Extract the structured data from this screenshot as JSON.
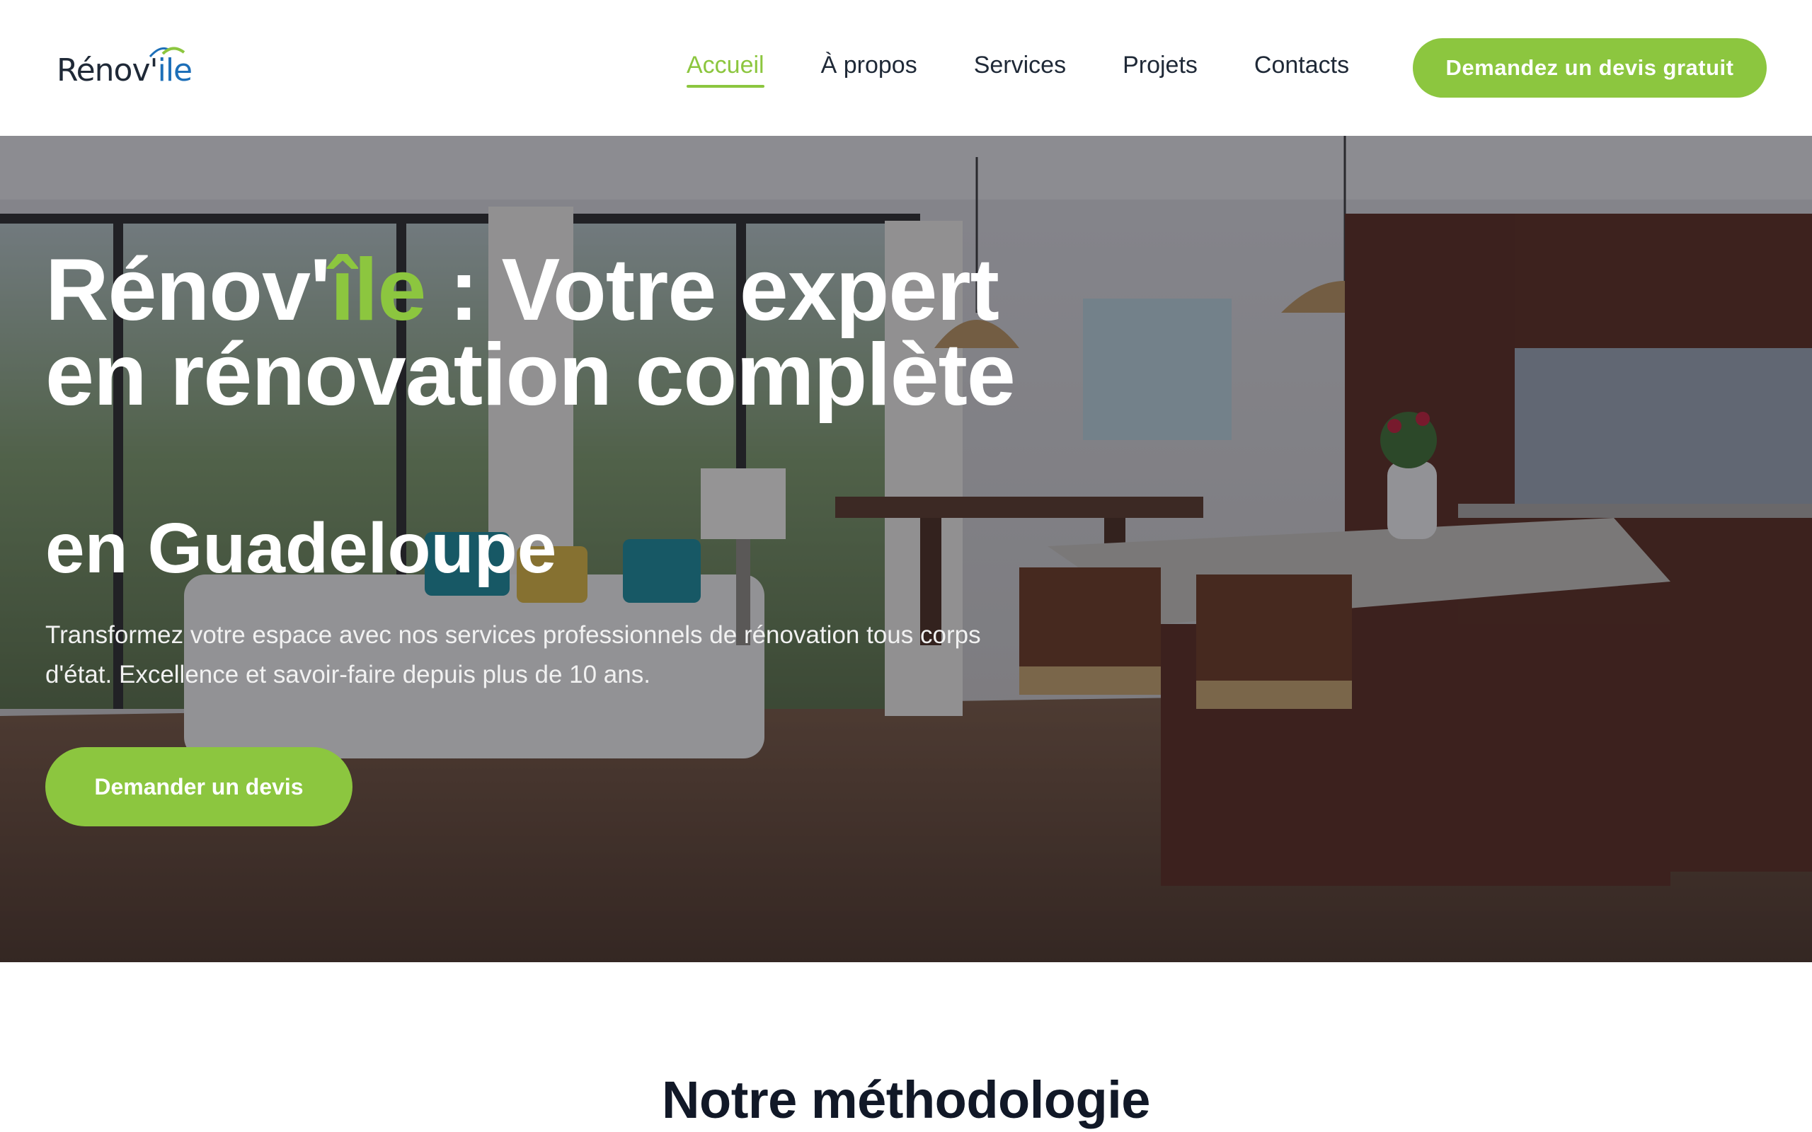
{
  "brand": {
    "logo_main": "Rénov'",
    "logo_accent": "ile"
  },
  "nav": {
    "items": [
      {
        "label": "Accueil",
        "active": true
      },
      {
        "label": "À propos",
        "active": false
      },
      {
        "label": "Services",
        "active": false
      },
      {
        "label": "Projets",
        "active": false
      },
      {
        "label": "Contacts",
        "active": false
      }
    ],
    "cta_label": "Demandez un devis gratuit"
  },
  "hero": {
    "title_part1": "Rénov'",
    "title_accent": "île",
    "title_part2": " : Votre expert en rénovation complète",
    "subtitle": "en Guadeloupe",
    "description": "Transformez votre espace avec nos services professionnels de rénovation tous corps d'état. Excellence et savoir-faire depuis plus de 10 ans.",
    "cta_label": "Demander un devis"
  },
  "methodology": {
    "title": "Notre méthodologie"
  },
  "colors": {
    "accent": "#8cc63f",
    "logo_blue": "#1d6fb8",
    "text_dark": "#111827"
  }
}
